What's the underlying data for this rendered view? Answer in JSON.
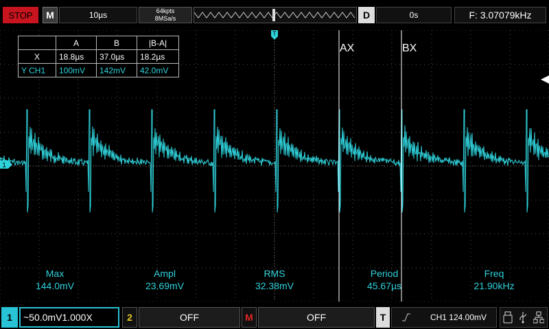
{
  "top_bar": {
    "run_state": "STOP",
    "mode": "M",
    "timebase": "10µs",
    "memory_depth": "64kpts",
    "sample_rate": "8MSa/s",
    "trigger_icon": "D",
    "trigger_delay": "0s",
    "frequency": "F: 3.07079kHz"
  },
  "cursors": {
    "headers": [
      "A",
      "B",
      "|B-A|"
    ],
    "rows": [
      {
        "label": "X",
        "values": [
          "18.8µs",
          "37.0µs",
          "18.2µs"
        ]
      },
      {
        "label": "Y CH1",
        "values": [
          "100mV",
          "142mV",
          "42.0mV"
        ]
      }
    ],
    "ax_label": "AX",
    "bx_label": "BX"
  },
  "markers": {
    "trigger_pos": "T",
    "channel_ground": "1"
  },
  "measurements": [
    {
      "name": "Max",
      "value": "144.0mV"
    },
    {
      "name": "Ampl",
      "value": "23.69mV"
    },
    {
      "name": "RMS",
      "value": "32.38mV"
    },
    {
      "name": "Period",
      "value": "45.67µs"
    },
    {
      "name": "Freq",
      "value": "21.90kHz"
    }
  ],
  "bottom_bar": {
    "ch1_num": "1",
    "ch1_info": "~50.0mV1.000X",
    "ch2_num": "2",
    "ch2_info": "OFF",
    "math_num": "M",
    "math_info": "OFF",
    "trig_num": "T",
    "trig_slope": "rising-edge-icon",
    "trig_info": "CH1 124.00mV"
  },
  "colors": {
    "trace": "#2fd3dc",
    "stop": "#c8141e",
    "ch1": "#29c3d6",
    "ch2": "#e8c82a",
    "math": "#e02626"
  }
}
